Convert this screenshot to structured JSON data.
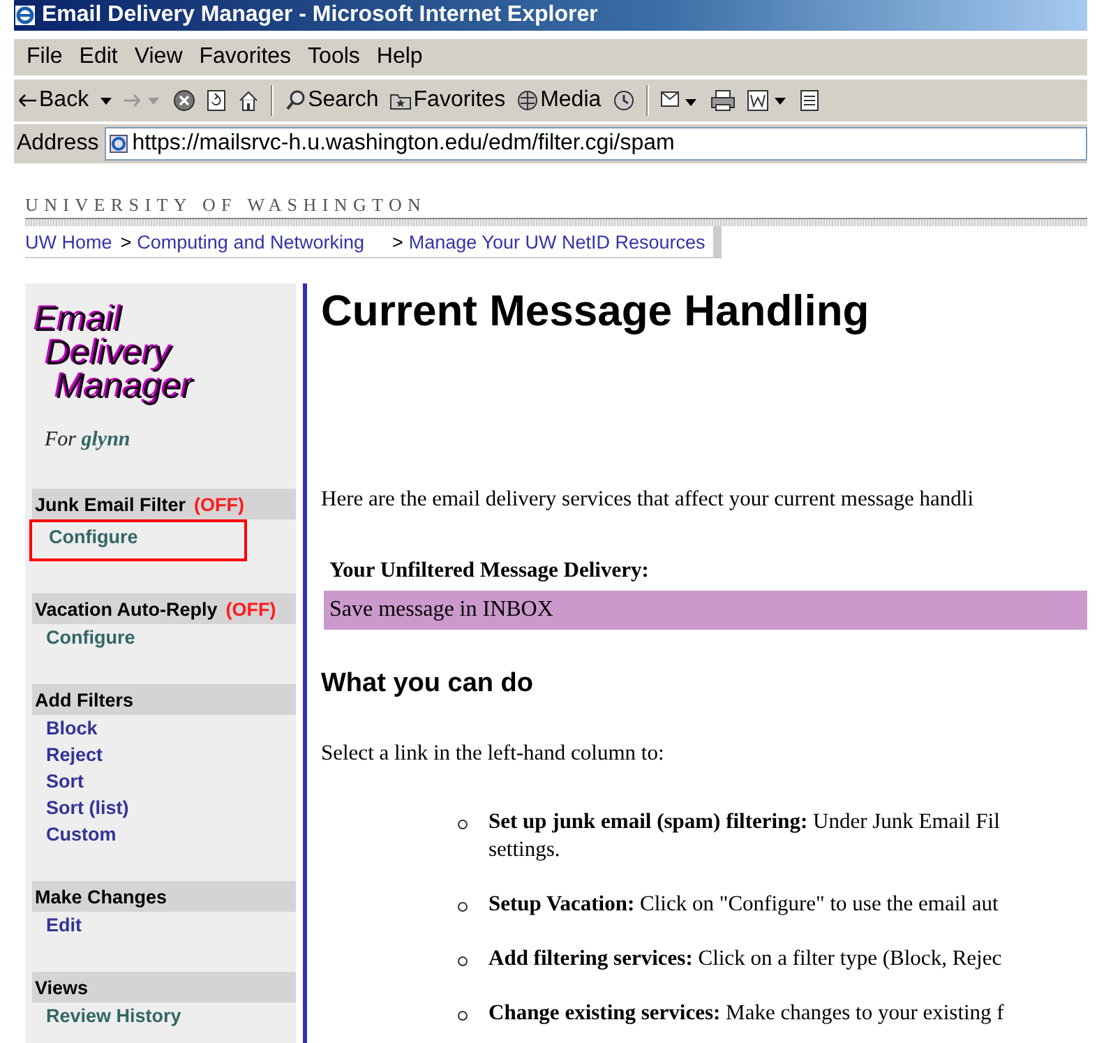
{
  "window": {
    "title": "Email Delivery Manager - Microsoft Internet Explorer"
  },
  "menu": [
    "File",
    "Edit",
    "View",
    "Favorites",
    "Tools",
    "Help"
  ],
  "toolbar": [
    {
      "kind": "back",
      "label": "Back"
    },
    {
      "kind": "forward"
    },
    {
      "kind": "stop"
    },
    {
      "kind": "refresh"
    },
    {
      "kind": "home"
    },
    {
      "kind": "separator"
    },
    {
      "kind": "search",
      "label": "Search"
    },
    {
      "kind": "favorites",
      "label": "Favorites"
    },
    {
      "kind": "media",
      "label": "Media"
    },
    {
      "kind": "history"
    },
    {
      "kind": "separator"
    },
    {
      "kind": "mail"
    },
    {
      "kind": "print"
    },
    {
      "kind": "edit"
    },
    {
      "kind": "discuss"
    }
  ],
  "address": {
    "label": "Address",
    "value": "https://mailsrvc-h.u.washington.edu/edm/filter.cgi/spam"
  },
  "site": {
    "name": "UNIVERSITY OF WASHINGTON",
    "breadcrumb": [
      {
        "kind": "link",
        "text": "UW Home"
      },
      {
        "kind": "sep",
        "text": ">"
      },
      {
        "kind": "link",
        "text": "Computing and Networking"
      },
      {
        "kind": "sep",
        "text": ">"
      },
      {
        "kind": "link",
        "text": "Manage Your UW NetID Resources"
      }
    ]
  },
  "sidebar": {
    "logo": [
      "Email",
      "Delivery",
      "Manager"
    ],
    "user_prefix": "For",
    "user": "glynn",
    "sections": [
      {
        "title": "Junk Email Filter",
        "status": "(OFF)",
        "links": [
          {
            "label": "Configure",
            "color": "#336666",
            "highlighted": true
          }
        ]
      },
      {
        "title": "Vacation Auto-Reply",
        "status": "(OFF)",
        "links": [
          {
            "label": "Configure",
            "color": "#336666",
            "highlighted": false
          }
        ]
      },
      {
        "title": "Add Filters",
        "links": [
          {
            "label": "Block",
            "color": "#333399",
            "highlighted": false
          },
          {
            "label": "Reject",
            "color": "#333399",
            "highlighted": false
          },
          {
            "label": "Sort",
            "color": "#333399",
            "highlighted": false
          },
          {
            "label": "Sort (list)",
            "color": "#333399",
            "highlighted": false
          },
          {
            "label": "Custom",
            "color": "#333399",
            "highlighted": false
          }
        ]
      },
      {
        "title": "Make Changes",
        "links": [
          {
            "label": "Edit",
            "color": "#333399",
            "highlighted": false
          }
        ]
      },
      {
        "title": "Views",
        "links": [
          {
            "label": "Review History",
            "color": "#336666",
            "highlighted": false
          }
        ]
      }
    ]
  },
  "main": {
    "title": "Current Message Handling",
    "intro": "Here are the email delivery services that affect your current message handli",
    "delivery": {
      "label": "Your Unfiltered Message Delivery:",
      "value": "Save message in INBOX"
    },
    "subheading": "What you can do",
    "prompt": "Select a link in the left-hand column to:",
    "bullets": [
      {
        "lines": [
          "**Set up junk email (spam) filtering:** Under Junk Email Fil",
          "settings."
        ]
      },
      {
        "lines": [
          "**Setup Vacation:** Click on \"Configure\" to use the email aut"
        ]
      },
      {
        "lines": [
          "**Add filtering services:** Click on a filter type (Block, Rejec"
        ]
      },
      {
        "lines": [
          "**Change existing services:** Make changes to your existing f"
        ]
      }
    ]
  }
}
